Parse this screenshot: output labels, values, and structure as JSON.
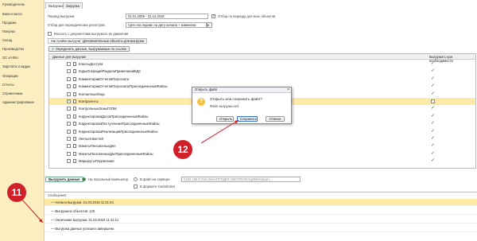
{
  "sidebar": {
    "items": [
      {
        "label": "Руководителю"
      },
      {
        "label": "Банк и касса"
      },
      {
        "label": "Продажи"
      },
      {
        "label": "Покупки"
      },
      {
        "label": "Склад"
      },
      {
        "label": "Производство"
      },
      {
        "label": "ОС и НМА"
      },
      {
        "label": "Зарплата и кадры"
      },
      {
        "label": "Операции"
      },
      {
        "label": "Отчеты"
      },
      {
        "label": "Справочники"
      },
      {
        "label": "Администрирование"
      }
    ]
  },
  "tabs": [
    {
      "label": "Выгрузка"
    },
    {
      "label": "Загрузка"
    }
  ],
  "form": {
    "period_label": "Период выгрузки:",
    "period_value": "01.01.2009 - 31.12.2018",
    "filter_label": "Отбор по периоду для всех объектов",
    "registers_label": "Отбор для периодических регистров:",
    "registers_value": "Срез последних на дату начала + изменени",
    "include_docs_label": "Вносить с документами выгружать их движения"
  },
  "subtabs": [
    {
      "label": "Настройки выгрузки"
    },
    {
      "label": "Дополнительные объекты для выгрузки"
    }
  ],
  "toolbar": {
    "define_by_links_label": "Определить данные, выгружаемые по ссылке"
  },
  "grid": {
    "col_data": "Данные для выгрузки",
    "col_export": "Выгружать при необходимости",
    "rows": [
      {
        "name": "КлассыДоступа",
        "checked": false,
        "export": true
      },
      {
        "name": "КодыОперацийРазделаПримечанийКДС",
        "checked": false,
        "export": true
      },
      {
        "name": "КомментарииОтчетовПерсоната",
        "checked": false,
        "export": true
      },
      {
        "name": "КомментарииОтчетовПерсоната/ПрисоединенныеФайлы",
        "checked": false,
        "export": true
      },
      {
        "name": "КонтактныеЛица",
        "checked": false,
        "export": true
      },
      {
        "name": "Контрагенты",
        "checked": true,
        "export": false,
        "selected": true
      },
      {
        "name": "КонтрольныеЗоныГЛОМ",
        "checked": false,
        "export": true
      },
      {
        "name": "КорректировкаДолгаПрисоединенныеФайлы",
        "checked": false,
        "export": true
      },
      {
        "name": "КорректировкаПоступленияПрисоединенныеФайлы",
        "checked": false,
        "export": true
      },
      {
        "name": "КорректировкаРеализацииПрисоединенныеФайлы",
        "checked": false,
        "export": true
      },
      {
        "name": "ЛентыНовостей",
        "checked": false,
        "export": true
      },
      {
        "name": "МакетыПенсионныхДел",
        "checked": false,
        "export": true
      },
      {
        "name": "МакетыПенсионныхДелПрисоединенныеФайлы",
        "checked": false,
        "export": true
      },
      {
        "name": "МаршрутыПодписания",
        "checked": false,
        "export": true
      }
    ]
  },
  "export_bar": {
    "export_button": "Выгрузить данные",
    "opt_local": "На локальный компьютер",
    "opt_server": "В файл на сервере:",
    "server_path": "\\\\192.168.0.0\\Archive\\ПУТДЕЯ ЭКСПЛУАТАЦИИ\\Новый (...",
    "fastinfoset": "В формате FastInfoSet"
  },
  "dialog": {
    "title": "Открыть файл",
    "question": "Открыть или сохранить файл?",
    "filename": "Файл выгрузки.xml",
    "open": "Открыть",
    "save": "Сохранить",
    "cancel": "Отмена"
  },
  "log": {
    "header": "Сообщения:",
    "lines": [
      {
        "text": "Начало выгрузки: 21.03.2019 11:31:04",
        "hl": true
      },
      {
        "text": "Выгружено объектов: 120",
        "hl": false
      },
      {
        "text": "Окончание выгрузки: 21.03.2019 11:31:11",
        "hl": false
      },
      {
        "text": "Выгрузка данных успешно завершена",
        "hl": false
      }
    ]
  },
  "badges": {
    "b11": "11",
    "b12": "12"
  },
  "colors": {
    "sidebar_bg": "#fbeec0",
    "highlight": "#fde9a8",
    "badge_red": "#d0202a",
    "arrow_red": "#d0202a",
    "check_green": "#2a8b2a"
  }
}
